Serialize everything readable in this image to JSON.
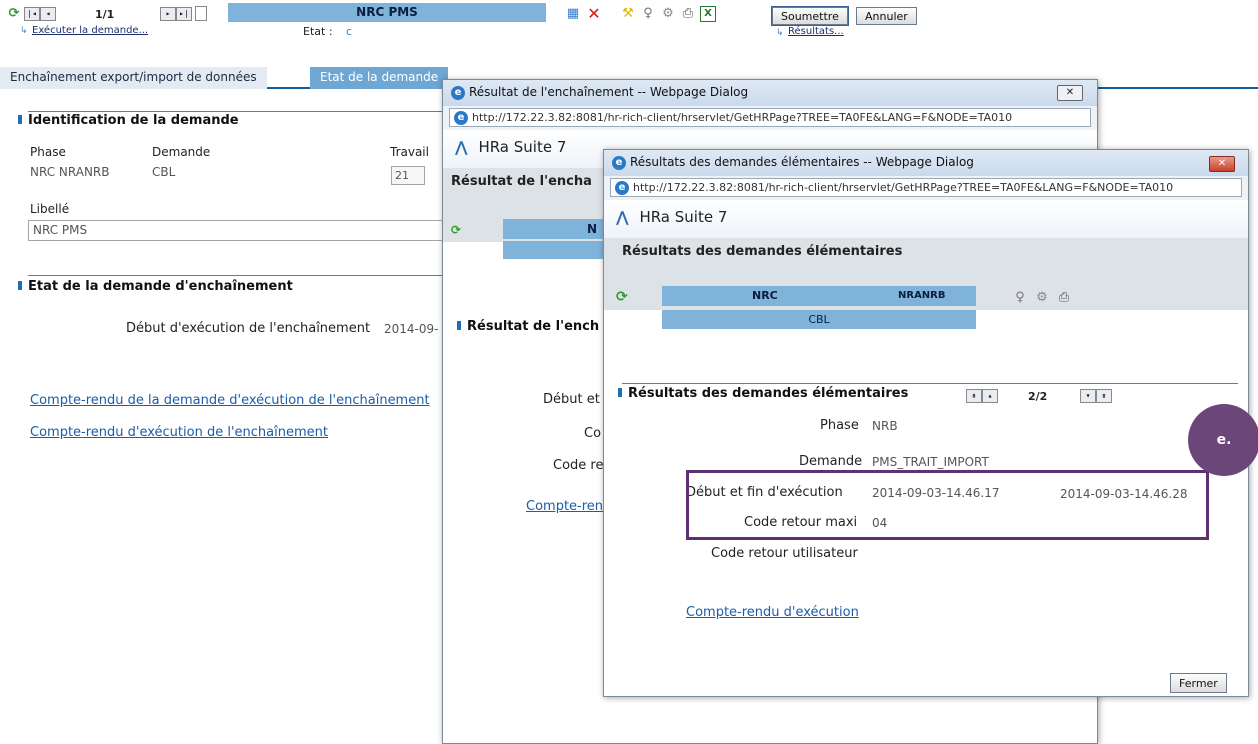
{
  "toolbar": {
    "page_indicator": "1/1",
    "title": "NRC PMS",
    "execute_link": "Exécuter la demande...",
    "etat_label": "Etat :",
    "results_link": "Résultats...",
    "submit_label": "Soumettre",
    "cancel_label": "Annuler",
    "icons": [
      "refresh-icon",
      "first-icon",
      "prev-icon",
      "next-icon",
      "last-icon",
      "document-icon",
      "grid-icon",
      "delete-icon",
      "wand-icon",
      "bulb-icon",
      "tools-icon",
      "print-icon",
      "excel-icon"
    ]
  },
  "tabs": [
    {
      "label": "Enchaînement export/import de données"
    },
    {
      "label": "Etat de la demande"
    }
  ],
  "main": {
    "identification_title": "Identification de la demande",
    "phase_header": "Phase",
    "demande_header": "Demande",
    "travail_header": "Travail",
    "phase_value": "NRC  NRANRB",
    "demande_value": "CBL",
    "travail_value": "21",
    "libelle_label": "Libellé",
    "libelle_value": "NRC PMS",
    "etat_title": "Etat de la demande d'enchaînement",
    "debut_label": "Début d'exécution de l'enchaînement",
    "debut_value": "2014-09-",
    "link1": "Compte-rendu de la demande d'exécution de l'enchaînement",
    "link2": "Compte-rendu d'exécution de l'enchaînement"
  },
  "dialog1": {
    "title": "Résultat de l'enchaînement -- Webpage Dialog",
    "url": "http://172.22.3.82:8081/hr-rich-client/hrservlet/GetHRPage?TREE=TA0FE&LANG=F&NODE=TA010",
    "brand": "HRa Suite 7",
    "heading": "Résultat de l'encha",
    "bar_text": "N",
    "section_title": "Résultat de l'ench",
    "row1": "Début et",
    "row2": "Co",
    "row3": "Code re",
    "link": "Compte-ren",
    "close": "✕"
  },
  "dialog2": {
    "title": "Résultats des demandes élémentaires -- Webpage Dialog",
    "url": "http://172.22.3.82:8081/hr-rich-client/hrservlet/GetHRPage?TREE=TA0FE&LANG=F&NODE=TA010",
    "brand": "HRa Suite 7",
    "heading": "Résultats des demandes élémentaires",
    "bar_left": "NRC",
    "bar_right": "NRANRB",
    "bar_sub": "CBL",
    "section_title": "Résultats des demandes élémentaires",
    "pager": "2/2",
    "phase_label": "Phase",
    "phase_value": "NRB",
    "demande_label": "Demande",
    "demande_value": "PMS_TRAIT_IMPORT",
    "debut_fin_label": "Début et fin d'exécution",
    "debut_value": "2014-09-03-14.46.17",
    "fin_value": "2014-09-03-14.46.28",
    "code_retour_label": "Code retour maxi",
    "code_retour_value": "04",
    "code_user_label": "Code retour utilisateur",
    "link": "Compte-rendu d'exécution",
    "close_button": "Fermer",
    "close": "✕"
  },
  "annotation": {
    "label": "e."
  },
  "colors": {
    "accent": "#7fb3d9",
    "highlight": "#5e2f72",
    "link": "#1a5da8"
  }
}
